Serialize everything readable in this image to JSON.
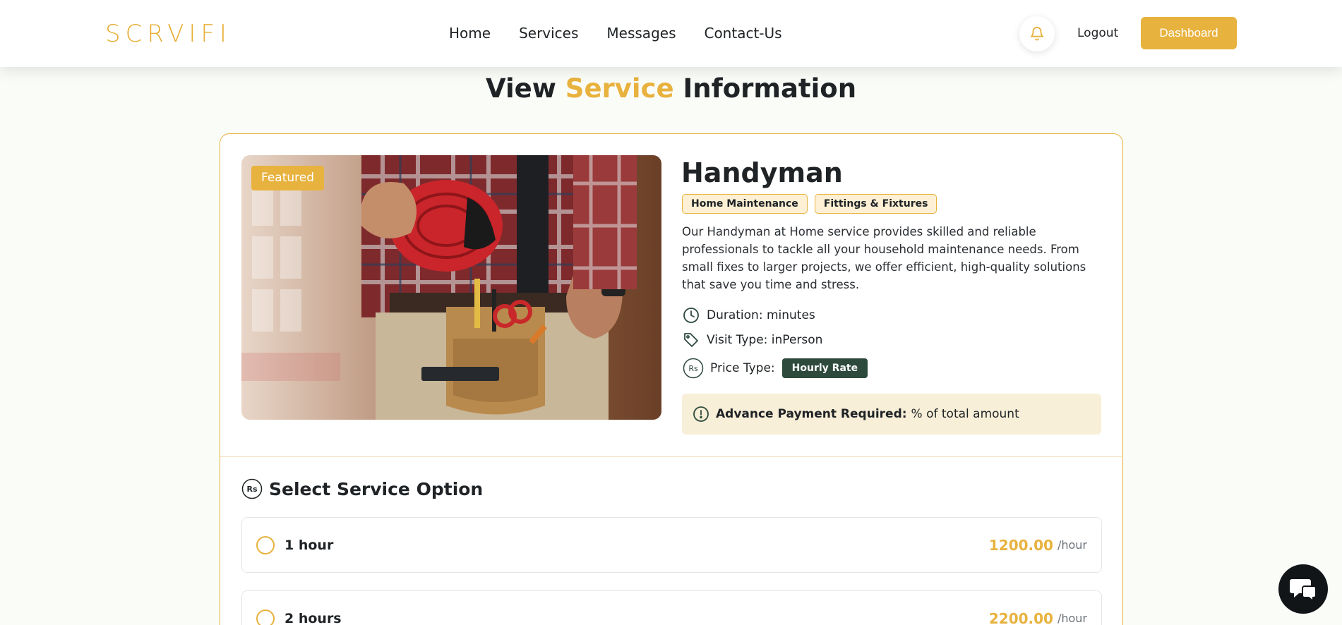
{
  "brand": {
    "logo_text": "SCRVIFI",
    "accent_color": "#e8b23e",
    "dark_green": "#2d4a3d"
  },
  "nav": {
    "items": [
      {
        "label": "Home"
      },
      {
        "label": "Services"
      },
      {
        "label": "Messages"
      },
      {
        "label": "Contact-Us"
      }
    ]
  },
  "header": {
    "logout_label": "Logout",
    "dashboard_label": "Dashboard",
    "bell_icon": "bell-icon"
  },
  "page": {
    "title_before": "View",
    "title_accent": "Service",
    "title_after": "Information"
  },
  "service": {
    "featured_badge": "Featured",
    "name": "Handyman",
    "tags": [
      "Home Maintenance",
      "Fittings & Fixtures"
    ],
    "description": "Our Handyman at Home service provides skilled and reliable professionals to tackle all your household maintenance needs. From small fixes to larger projects, we offer efficient, high-quality solutions that save you time and stress.",
    "duration_text": "Duration: minutes",
    "visit_type_text": "Visit Type: inPerson",
    "price_type_label": "Price Type:",
    "price_type_value": "Hourly Rate",
    "currency_badge": "Rs",
    "advance_label": "Advance Payment Required:",
    "advance_text": "% of total amount"
  },
  "options": {
    "heading": "Select Service Option",
    "items": [
      {
        "label": "1 hour",
        "price": "1200.00",
        "unit": "/hour"
      },
      {
        "label": "2 hours",
        "price": "2200.00",
        "unit": "/hour"
      }
    ]
  },
  "chat": {
    "icon": "chat-icon"
  }
}
